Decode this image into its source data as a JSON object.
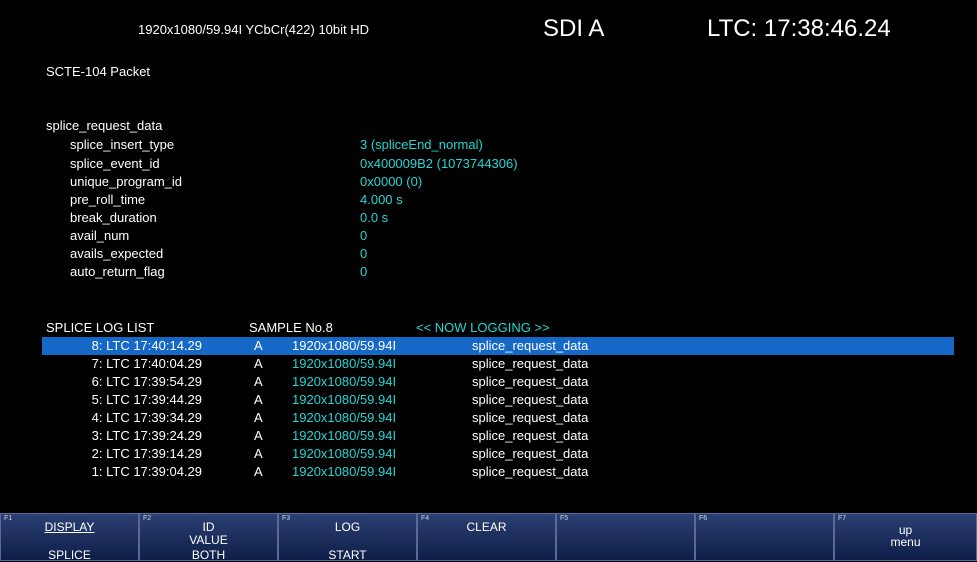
{
  "status": {
    "format": "1920x1080/59.94I YCbCr(422) 10bit HD",
    "input": "SDI A",
    "ltc": "LTC: 17:38:46.24"
  },
  "packet_title": "SCTE-104 Packet",
  "section_title": "splice_request_data",
  "params": [
    {
      "name": "splice_insert_type",
      "value": "3 (spliceEnd_normal)"
    },
    {
      "name": "splice_event_id",
      "value": "0x400009B2 (1073744306)"
    },
    {
      "name": "unique_program_id",
      "value": "0x0000 (0)"
    },
    {
      "name": "pre_roll_time",
      "value": "4.000 s"
    },
    {
      "name": "break_duration",
      "value": "0.0 s"
    },
    {
      "name": "avail_num",
      "value": "0"
    },
    {
      "name": "avails_expected",
      "value": "0"
    },
    {
      "name": "auto_return_flag",
      "value": "0"
    }
  ],
  "log": {
    "title": "SPLICE LOG LIST",
    "sample": "SAMPLE No.8",
    "status": "<< NOW LOGGING >>",
    "rows": [
      {
        "ltc": "8: LTC 17:40:14.29",
        "input": "A",
        "format": "1920x1080/59.94I",
        "type": "splice_request_data"
      },
      {
        "ltc": "7: LTC 17:40:04.29",
        "input": "A",
        "format": "1920x1080/59.94I",
        "type": "splice_request_data"
      },
      {
        "ltc": "6: LTC 17:39:54.29",
        "input": "A",
        "format": "1920x1080/59.94I",
        "type": "splice_request_data"
      },
      {
        "ltc": "5: LTC 17:39:44.29",
        "input": "A",
        "format": "1920x1080/59.94I",
        "type": "splice_request_data"
      },
      {
        "ltc": "4: LTC 17:39:34.29",
        "input": "A",
        "format": "1920x1080/59.94I",
        "type": "splice_request_data"
      },
      {
        "ltc": "3: LTC 17:39:24.29",
        "input": "A",
        "format": "1920x1080/59.94I",
        "type": "splice_request_data"
      },
      {
        "ltc": "2: LTC 17:39:14.29",
        "input": "A",
        "format": "1920x1080/59.94I",
        "type": "splice_request_data"
      },
      {
        "ltc": "1: LTC 17:39:04.29",
        "input": "A",
        "format": "1920x1080/59.94I",
        "type": "splice_request_data"
      }
    ]
  },
  "fkeys": [
    {
      "num": "F1",
      "l1": "DISPLAY",
      "l2": "",
      "l3": "SPLICE"
    },
    {
      "num": "F2",
      "l1": "ID",
      "l2": "VALUE",
      "l3": "BOTH"
    },
    {
      "num": "F3",
      "l1": "LOG",
      "l2": "",
      "l3": "START"
    },
    {
      "num": "F4",
      "l1": "CLEAR",
      "l2": "",
      "l3": ""
    },
    {
      "num": "F5",
      "l1": "",
      "l2": "",
      "l3": ""
    },
    {
      "num": "F6",
      "l1": "",
      "l2": "",
      "l3": ""
    },
    {
      "num": "F7",
      "l1": "",
      "l2": "up",
      "l3": "menu"
    }
  ],
  "colors": {
    "accent_text": "#22d6d6",
    "selection": "#1668c6",
    "fn_button": "#1a2c5c"
  }
}
